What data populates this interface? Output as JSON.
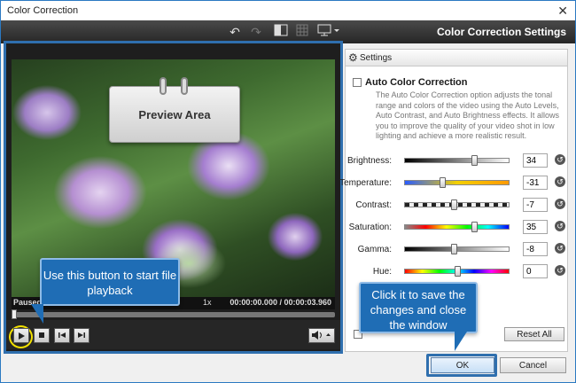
{
  "window": {
    "title": "Color Correction",
    "close_glyph": "✕"
  },
  "toolbar": {
    "heading": "Color Correction Settings",
    "icons": [
      "undo-icon",
      "redo-icon",
      "split-view-icon",
      "grid-icon",
      "monitor-icon"
    ]
  },
  "preview": {
    "card_label": "Preview Area",
    "status": "Paused",
    "speed": "1x",
    "time": "00:00:00.000 / 00:00:03.960"
  },
  "settings": {
    "header": "Settings",
    "auto_label": "Auto Color Correction",
    "auto_desc": "The Auto Color Correction option adjusts the tonal range and colors of the video using the Auto Levels, Auto Contrast, and Auto Brightness effects. It allows you to improve the quality of your video shot in low lighting and achieve a more realistic result.",
    "params": [
      {
        "label": "Brightness:",
        "value": "34",
        "pos": 0.67
      },
      {
        "label": "Temperature:",
        "value": "-31",
        "pos": 0.35
      },
      {
        "label": "Contrast:",
        "value": "-7",
        "pos": 0.46
      },
      {
        "label": "Saturation:",
        "value": "35",
        "pos": 0.67
      },
      {
        "label": "Gamma:",
        "value": "-8",
        "pos": 0.46
      },
      {
        "label": "Hue:",
        "value": "0",
        "pos": 0.5
      }
    ],
    "reset_all": "Reset All"
  },
  "callouts": {
    "play": "Use this button to start file playback",
    "ok": "Click it to save the changes and close the window"
  },
  "buttons": {
    "ok": "OK",
    "cancel": "Cancel"
  }
}
